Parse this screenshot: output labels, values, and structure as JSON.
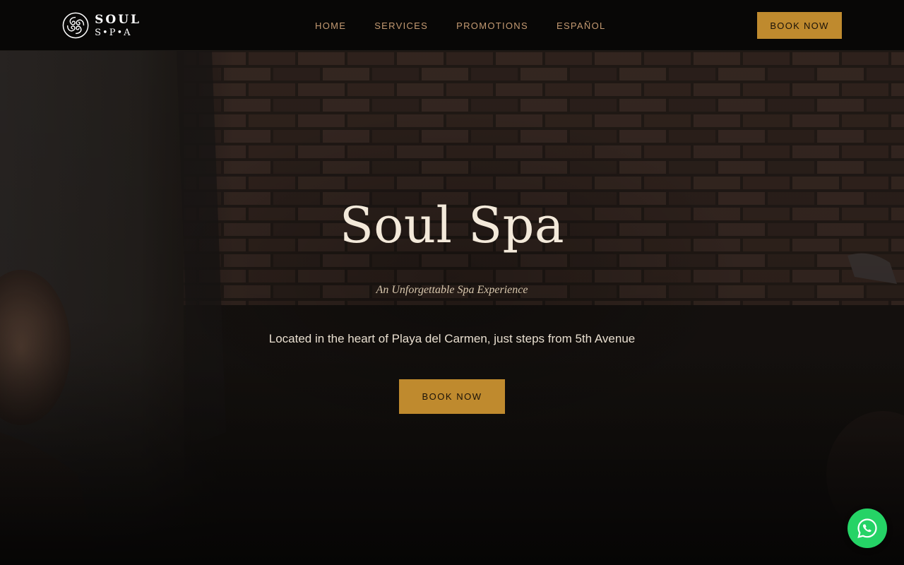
{
  "brand": {
    "logo_line1": "SOUL",
    "logo_line2": "S•P•A"
  },
  "nav": {
    "items": [
      {
        "label": "HOME"
      },
      {
        "label": "SERVICES"
      },
      {
        "label": "PROMOTIONS"
      },
      {
        "label": "ESPAÑOL"
      }
    ],
    "cta_label": "BOOK NOW"
  },
  "hero": {
    "title": "Soul Spa",
    "subtitle": "An Unforgettable Spa Experience",
    "description": "Located in the heart of Playa del Carmen, just steps from 5th Avenue",
    "cta_label": "BOOK NOW"
  },
  "floating": {
    "whatsapp_icon": "whatsapp-icon"
  },
  "colors": {
    "accent": "#bf8a2e",
    "nav_text": "#c49a72",
    "header_bg": "#080706",
    "whatsapp": "#25d366"
  }
}
